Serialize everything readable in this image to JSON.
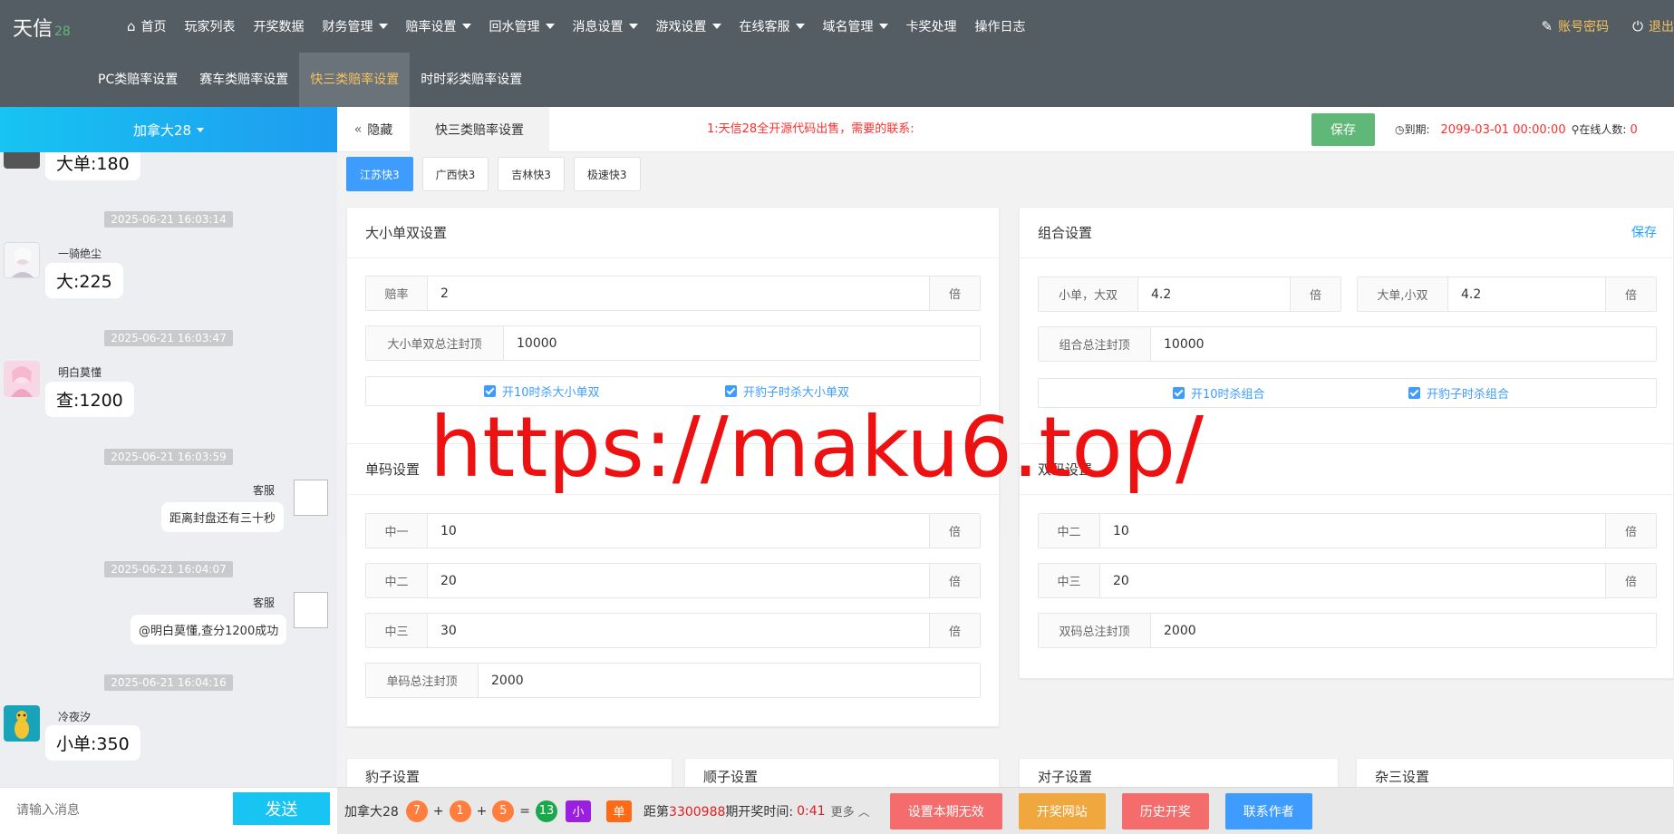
{
  "app": {
    "logo": "天信",
    "logo_suffix": "28"
  },
  "nav": {
    "items": [
      {
        "label": "首页",
        "icon": "home-icon",
        "dropdown": false
      },
      {
        "label": "玩家列表",
        "dropdown": false
      },
      {
        "label": "开奖数据",
        "dropdown": false
      },
      {
        "label": "财务管理",
        "dropdown": true
      },
      {
        "label": "赔率设置",
        "dropdown": true
      },
      {
        "label": "回水管理",
        "dropdown": true
      },
      {
        "label": "消息设置",
        "dropdown": true
      },
      {
        "label": "游戏设置",
        "dropdown": true
      },
      {
        "label": "在线客服",
        "dropdown": true
      },
      {
        "label": "域名管理",
        "dropdown": true
      },
      {
        "label": "卡奖处理",
        "dropdown": false
      },
      {
        "label": "操作日志",
        "dropdown": false
      }
    ],
    "account": "账号密码",
    "logout": "退出",
    "subnav": [
      "PC类赔率设置",
      "赛车类赔率设置",
      "快三类赔率设置",
      "时时彩类赔率设置"
    ],
    "subnav_active": 2
  },
  "chat": {
    "room": "加拿大28",
    "messages": [
      {
        "type": "bubble",
        "text": "大单:180"
      },
      {
        "type": "time",
        "text": "2025-06-21 16:03:14"
      },
      {
        "type": "user",
        "name": "一骑绝尘",
        "text": "大:225"
      },
      {
        "type": "time",
        "text": "2025-06-21 16:03:47"
      },
      {
        "type": "user",
        "name": "明白莫懂",
        "text": "查:1200"
      },
      {
        "type": "time",
        "text": "2025-06-21 16:03:59"
      },
      {
        "type": "kefu",
        "name": "客服",
        "text": "距离封盘还有三十秒"
      },
      {
        "type": "time",
        "text": "2025-06-21 16:04:07"
      },
      {
        "type": "kefu",
        "name": "客服",
        "text": "@明白莫懂,查分1200成功"
      },
      {
        "type": "time",
        "text": "2025-06-21 16:04:16"
      },
      {
        "type": "user",
        "name": "冷夜汐",
        "text": "小单:350"
      }
    ],
    "input_placeholder": "请输入消息",
    "send_label": "发送"
  },
  "toolbar": {
    "hide_label": "隐藏",
    "current_tab": "快三类赔率设置",
    "notice": "1:天信28全开源代码出售，需要的联系:",
    "save_label": "保存",
    "expire_label": "到期:",
    "expire_value": "2099-03-01 00:00:00",
    "online_label": "在线人数:",
    "online_value": "0"
  },
  "game_tabs": [
    "江苏快3",
    "广西快3",
    "吉林快3",
    "极速快3"
  ],
  "game_tab_active": 0,
  "panels": {
    "dxds": {
      "title": "大小单双设置",
      "rate_label": "赔率",
      "rate_value": "2",
      "unit": "倍",
      "cap_label": "大小单双总注封顶",
      "cap_value": "10000",
      "chk1": "开10时杀大小单双",
      "chk2": "开豹子时杀大小单双"
    },
    "combo": {
      "title": "组合设置",
      "save": "保存",
      "a_label": "小单，大双",
      "a_value": "4.2",
      "b_label": "大单,小双",
      "b_value": "4.2",
      "unit": "倍",
      "cap_label": "组合总注封顶",
      "cap_value": "10000",
      "chk1": "开10时杀组合",
      "chk2": "开豹子时杀组合"
    },
    "single": {
      "title": "单码设置",
      "unit": "倍",
      "rows": [
        {
          "label": "中一",
          "value": "10"
        },
        {
          "label": "中二",
          "value": "20"
        },
        {
          "label": "中三",
          "value": "30"
        }
      ],
      "cap_label": "单码总注封顶",
      "cap_value": "2000"
    },
    "double": {
      "title": "双码设置",
      "unit": "倍",
      "rows": [
        {
          "label": "中二",
          "value": "10"
        },
        {
          "label": "中三",
          "value": "20"
        }
      ],
      "cap_label": "双码总注封顶",
      "cap_value": "2000"
    },
    "bottom_titles": [
      "豹子设置",
      "顺子设置",
      "对子设置",
      "杂三设置"
    ]
  },
  "watermark": "https://maku6.top/",
  "bottombar": {
    "name": "加拿大28",
    "balls": [
      "7",
      "1",
      "5"
    ],
    "sum": "13",
    "tag_size": "小",
    "tag_parity": "单",
    "issue_prefix": "距第",
    "issue": "3300988",
    "issue_suffix": "期开奖时间:",
    "countdown": "0:41",
    "more": "更多",
    "buttons": [
      {
        "label": "设置本期无效",
        "color": "#f56c6c"
      },
      {
        "label": "开奖网站",
        "color": "#f0a73e"
      },
      {
        "label": "历史开奖",
        "color": "#f56c6c"
      },
      {
        "label": "联系作者",
        "color": "#3e9cff"
      }
    ]
  },
  "colors": {
    "topbar": "#545c64",
    "accent_yellow": "#f5c25e",
    "primary_blue": "#3e9cff",
    "chat_blue": "#17c4f2",
    "save_green": "#5fb878",
    "notice_red": "#ff2d2d"
  }
}
